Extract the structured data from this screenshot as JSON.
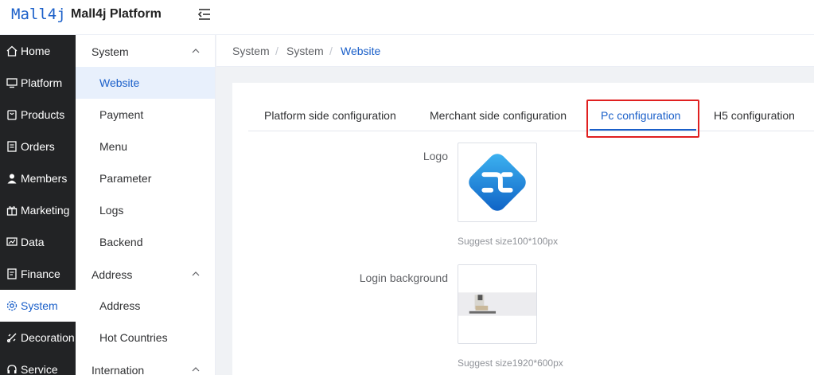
{
  "header": {
    "logo_text": "Mall4j",
    "title": "Mall4j Platform"
  },
  "sidebar": {
    "items": [
      {
        "label": "Home",
        "icon": "home-icon"
      },
      {
        "label": "Platform",
        "icon": "monitor-icon"
      },
      {
        "label": "Products",
        "icon": "bag-icon"
      },
      {
        "label": "Orders",
        "icon": "document-icon"
      },
      {
        "label": "Members",
        "icon": "user-icon"
      },
      {
        "label": "Marketing",
        "icon": "gift-icon"
      },
      {
        "label": "Data",
        "icon": "chart-icon"
      },
      {
        "label": "Finance",
        "icon": "wallet-icon"
      },
      {
        "label": "System",
        "icon": "gear-icon",
        "active": true
      },
      {
        "label": "Decoration",
        "icon": "brush-icon"
      },
      {
        "label": "Service",
        "icon": "headset-icon"
      }
    ]
  },
  "submenu": {
    "group_system": "System",
    "group_address": "Address",
    "group_internation": "Internation",
    "items": [
      "Website",
      "Payment",
      "Menu",
      "Parameter",
      "Logs",
      "Backend",
      "Address",
      "Hot Countries"
    ]
  },
  "breadcrumb": {
    "items": [
      "System",
      "System",
      "Website"
    ],
    "separator": "/"
  },
  "tabs": [
    "Platform side configuration",
    "Merchant side configuration",
    "Pc configuration",
    "H5 configuration"
  ],
  "form": {
    "logo_label": "Logo",
    "logo_hint": "Suggest size100*100px",
    "login_bg_label": "Login background",
    "login_bg_hint": "Suggest size1920*600px"
  },
  "colors": {
    "accent": "#1a5fc9",
    "sidebar_bg": "#222325",
    "highlight": "#e02020"
  }
}
